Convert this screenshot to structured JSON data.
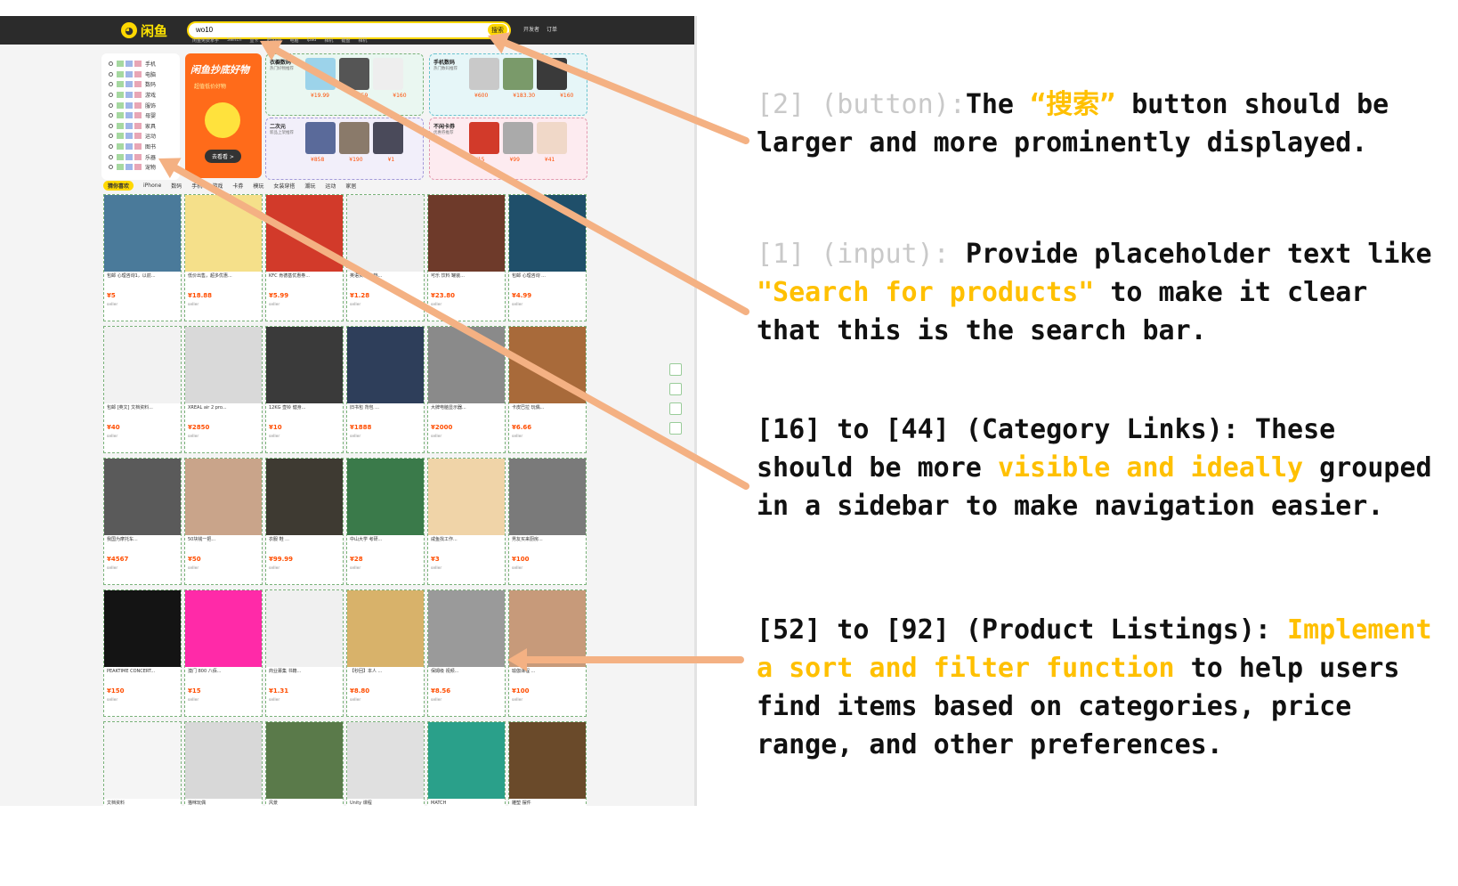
{
  "app": {
    "logo_text": "闲鱼",
    "search_value": "wo10",
    "search_button": "搜索",
    "hot_words": [
      "闲鱼免费拿手",
      "Switch",
      "显卡",
      "iPhone",
      "电脑",
      "Ipad",
      "相机",
      "键盘",
      "相机"
    ],
    "top_links": [
      "开发者",
      "订单"
    ]
  },
  "sidebar": {
    "rows": [
      "手机",
      "电脑",
      "数码",
      "游戏",
      "服饰",
      "母婴",
      "家具",
      "运动",
      "图书",
      "乐器",
      "宠物"
    ]
  },
  "promo": {
    "title": "闲鱼抄底好物",
    "subtitle": "超值低价好物",
    "button": "去看看 >"
  },
  "category_cards": [
    {
      "title": "衣橱数码",
      "sub": "热门好物推荐",
      "prices": [
        "¥19.99",
        "¥259",
        "¥160"
      ]
    },
    {
      "title": "手机数码",
      "sub": "热门数码推荐",
      "prices": [
        "¥600",
        "¥183.30",
        "¥160"
      ]
    },
    {
      "title": "二次元",
      "sub": "新品上架推荐",
      "prices": [
        "¥858",
        "¥190",
        "¥1"
      ]
    },
    {
      "title": "不闲卡券",
      "sub": "优惠券推荐",
      "prices": [
        "¥15",
        "¥99",
        "¥41"
      ]
    }
  ],
  "tabs": [
    "猜你喜欢",
    "iPhone",
    "数码",
    "手机",
    "游戏",
    "卡券",
    "模玩",
    "女装穿搭",
    "潮玩",
    "运动",
    "家居"
  ],
  "products": [
    {
      "title": "包邮 心理咨询1，以前...",
      "price": "¥5",
      "seller": "seller",
      "color": "#4a7a9a"
    },
    {
      "title": "低价出售，超多优惠...",
      "price": "¥18.88",
      "seller": "seller",
      "color": "#f5e08a"
    },
    {
      "title": "KFC 肯德基优惠券...",
      "price": "¥5.99",
      "seller": "seller",
      "color": "#d23a2a"
    },
    {
      "title": "英语资料 文档...",
      "price": "¥1.28",
      "seller": "seller",
      "color": "#eeeeee"
    },
    {
      "title": "可乐 饮料 罐装...",
      "price": "¥23.80",
      "seller": "seller",
      "color": "#6e3a2a"
    },
    {
      "title": "包邮 心理咨询 ...",
      "price": "¥4.99",
      "seller": "seller",
      "color": "#1f4f6a"
    },
    {
      "title": "包邮 [英文] 文档资料...",
      "price": "¥40",
      "seller": "seller",
      "color": "#f2f2f2"
    },
    {
      "title": "XREAL air 2 pro...",
      "price": "¥2850",
      "seller": "seller",
      "color": "#d9d9d9"
    },
    {
      "title": "12KG 壶铃 健身...",
      "price": "¥10",
      "seller": "seller",
      "color": "#3a3a3a"
    },
    {
      "title": "旧书包 背包 ...",
      "price": "¥1888",
      "seller": "seller",
      "color": "#2e3e5a"
    },
    {
      "title": "大牌电脑显示器...",
      "price": "¥2000",
      "seller": "seller",
      "color": "#8a8a8a"
    },
    {
      "title": "卡皮巴拉 玩偶...",
      "price": "¥6.66",
      "seller": "seller",
      "color": "#a86a3a"
    },
    {
      "title": "我国为摩托车...",
      "price": "¥4567",
      "seller": "seller",
      "color": "#5a5a5a"
    },
    {
      "title": "50块钱一把...",
      "price": "¥50",
      "seller": "seller",
      "color": "#c9a48a"
    },
    {
      "title": "衣服 鞋 ...",
      "price": "¥99.99",
      "seller": "seller",
      "color": "#3e3a32"
    },
    {
      "title": "中山大学 考研...",
      "price": "¥28",
      "seller": "seller",
      "color": "#3a7a4a"
    },
    {
      "title": "咸鱼找工作...",
      "price": "¥3",
      "seller": "seller",
      "color": "#f0d4a8"
    },
    {
      "title": "男友买来厨房...",
      "price": "¥100",
      "seller": "seller",
      "color": "#7a7a7a"
    },
    {
      "title": "PEAKTIME CONCERT...",
      "price": "¥150",
      "seller": "seller",
      "color": "#141414"
    },
    {
      "title": "澳门 800 八佰...",
      "price": "¥15",
      "seller": "seller",
      "color": "#ff2aa8"
    },
    {
      "title": "商业募集 书籍...",
      "price": "¥1.31",
      "seller": "seller",
      "color": "#f0f0f0"
    },
    {
      "title": "【秒回】本人 ...",
      "price": "¥8.80",
      "seller": "seller",
      "color": "#d8b26a"
    },
    {
      "title": "保姆级 视频...",
      "price": "¥8.56",
      "seller": "seller",
      "color": "#9a9a9a"
    },
    {
      "title": "瑜伽课程 ...",
      "price": "¥100",
      "seller": "seller",
      "color": "#c79a7a"
    },
    {
      "title": "文档资料",
      "price": "¥",
      "seller": "seller",
      "color": "#f5f5f5"
    },
    {
      "title": "猫咪玩偶",
      "price": "¥",
      "seller": "seller",
      "color": "#d8d8d8"
    },
    {
      "title": "风景",
      "price": "¥",
      "seller": "seller",
      "color": "#5a7a4a"
    },
    {
      "title": "Unity 课程",
      "price": "¥",
      "seller": "seller",
      "color": "#e0e0e0"
    },
    {
      "title": "MATCH",
      "price": "¥",
      "seller": "seller",
      "color": "#2aa08a"
    },
    {
      "title": "雕塑 摆件",
      "price": "¥",
      "seller": "seller",
      "color": "#6a4a2a"
    }
  ],
  "notes": {
    "n1_tag": "[2] (button):",
    "n1_a": "The ",
    "n1_hl": "“搜索”",
    "n1_b": " button should be larger and more prominently displayed.",
    "n2_tag": "[1] (input): ",
    "n2_a": "Provide placeholder text like ",
    "n2_hl": "\"Search for products\"",
    "n2_b": " to make it clear that this is the search bar.",
    "n3_a": "[16] to [44] (Category Links): These should be more ",
    "n3_hl": "visible and ideally",
    "n3_b": " grouped in a sidebar to make navigation easier.",
    "n4_a": "[52] to [92] (Product Listings): ",
    "n4_hl": "Implement a sort and filter function",
    "n4_b": " to help users find items based on categories, price range, and other preferences."
  },
  "arrow_color": "#f4b183"
}
